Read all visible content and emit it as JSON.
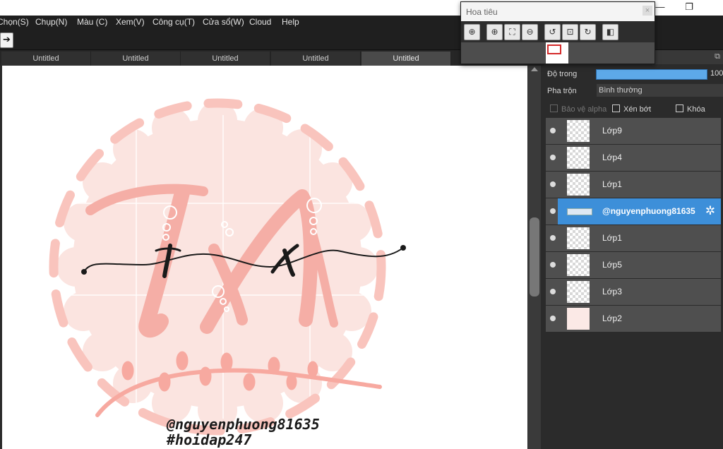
{
  "menubar": {
    "items": [
      "Chọn(S)",
      "Chụp(N)",
      "Màu (C)",
      "Xem(V)",
      "Công cụ(T)",
      "Cửa sổ(W)",
      "Cloud",
      "Help"
    ]
  },
  "window_controls": {
    "minimize": "—",
    "restore": "❐"
  },
  "toolbar": {
    "arrow_icon": "arrow-right"
  },
  "tabs": [
    "Untitled",
    "Untitled",
    "Untitled",
    "Untitled",
    "Untitled"
  ],
  "active_tab_index": 4,
  "navigator": {
    "title": "Hoa tiêu",
    "close_glyph": "×",
    "tools": [
      "zoom-fit-icon",
      "zoom-in-icon",
      "fit-window-icon",
      "zoom-out-icon",
      "rotate-left-icon",
      "reset-view-icon",
      "rotate-right-icon",
      "flip-icon"
    ]
  },
  "layer_panel": {
    "opacity_label": "Độ trong",
    "opacity_value": "100",
    "opacity_fraction": 1.0,
    "blend_label": "Pha trộn",
    "blend_value": "Bình thường",
    "protect_alpha": "Bảo vệ alpha",
    "clipping": "Xén bớt",
    "lock": "Khóa",
    "layers": [
      {
        "name": "Lớp9",
        "selected": false
      },
      {
        "name": "Lớp4",
        "selected": false
      },
      {
        "name": "Lớp1",
        "selected": false
      },
      {
        "name": "@nguyenphuong81635",
        "selected": true
      },
      {
        "name": "Lớp1",
        "selected": false
      },
      {
        "name": "Lớp5",
        "selected": false
      },
      {
        "name": "Lớp3",
        "selected": false
      },
      {
        "name": "Lớp2",
        "selected": false
      }
    ]
  },
  "canvas": {
    "signature_line1": "@nguyenphuong81635",
    "signature_line2": "#hoidap247",
    "accent_pink": "#f7b8b0",
    "accent_dark": "#1a1a1a"
  }
}
